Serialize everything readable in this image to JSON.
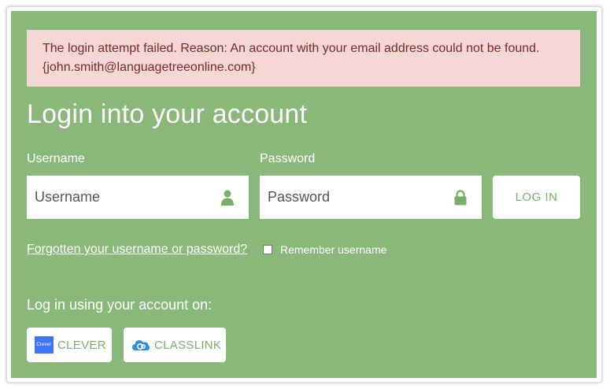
{
  "alert": {
    "line1": "The login attempt failed. Reason: An account with your email address could not be found.",
    "line2": "{john.smith@languagetreeonline.com}"
  },
  "page_title": "Login into your account",
  "username": {
    "label": "Username",
    "placeholder": "Username",
    "icon": "user-icon"
  },
  "password": {
    "label": "Password",
    "placeholder": "Password",
    "icon": "lock-icon"
  },
  "login_button": "LOG IN",
  "forgot_link": "Forgotten your username or password?",
  "remember": {
    "label": "Remember username",
    "checked": false
  },
  "sso": {
    "label": "Log in using your account on:",
    "providers": [
      {
        "name": "CLEVER",
        "logo_text": "Clever"
      },
      {
        "name": "CLASSLINK"
      }
    ]
  },
  "colors": {
    "panel": "#8ab77a",
    "alert_bg": "#f5d8d6",
    "alert_text": "#7a2a26",
    "accent": "#7aac6a"
  }
}
